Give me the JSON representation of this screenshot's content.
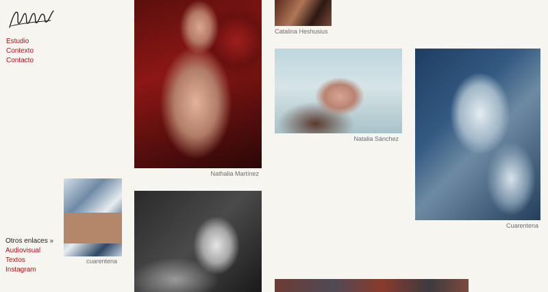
{
  "nav": {
    "items": [
      "Estudio",
      "Contexto",
      "Contacto"
    ]
  },
  "links": {
    "heading": "Otros enlaces »",
    "items": [
      "Audiovisual",
      "Textos",
      "Instagram"
    ]
  },
  "gallery": {
    "captions": {
      "nathalia": "Nathalia Martínez",
      "catalina": "Catalina Heshusius",
      "natalia": "Natalia Sánchez",
      "cuarentena_blue": "Cuarentena",
      "cuarentena_collage": "cuarentena"
    }
  },
  "colors": {
    "background": "#f7f5f0",
    "link": "#a3141c",
    "caption": "#6d6d6d"
  },
  "icons": {
    "logo": "handwritten-signature-logo"
  }
}
